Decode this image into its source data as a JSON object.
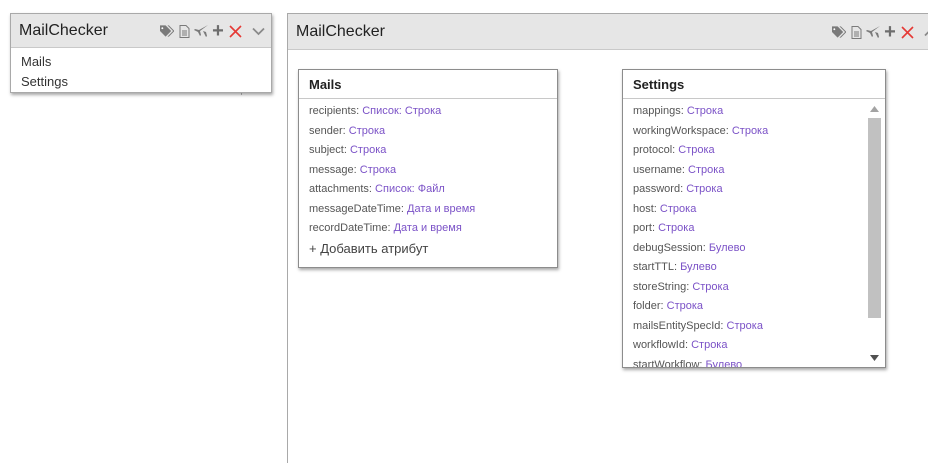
{
  "left_panel": {
    "title": "MailChecker",
    "items": [
      "Mails",
      "Settings"
    ]
  },
  "canvas": {
    "title": "MailChecker"
  },
  "icons": {
    "tags": "tags-icon",
    "document": "document-icon",
    "rocket": "rocket-icon",
    "add": "plus-icon",
    "close": "close-icon",
    "collapse": "chevron-down-icon",
    "expand": "chevron-up-icon"
  },
  "colors": {
    "type_text": "#7b52c7",
    "close_icon": "#e53935",
    "header_bg": "#e6e6e6"
  },
  "mails_entity": {
    "title": "Mails",
    "attributes": [
      {
        "name": "recipients:",
        "type": "Список: Строка"
      },
      {
        "name": "sender:",
        "type": "Строка"
      },
      {
        "name": "subject:",
        "type": "Строка"
      },
      {
        "name": "message:",
        "type": "Строка"
      },
      {
        "name": "attachments:",
        "type": "Список: Файл"
      },
      {
        "name": "messageDateTime:",
        "type": "Дата и время"
      },
      {
        "name": "recordDateTime:",
        "type": "Дата и время"
      }
    ],
    "add_label": "+ Добавить атрибут"
  },
  "settings_entity": {
    "title": "Settings",
    "attributes": [
      {
        "name": "mappings:",
        "type": "Строка"
      },
      {
        "name": "workingWorkspace:",
        "type": "Строка"
      },
      {
        "name": "protocol:",
        "type": "Строка"
      },
      {
        "name": "username:",
        "type": "Строка"
      },
      {
        "name": "password:",
        "type": "Строка"
      },
      {
        "name": "host:",
        "type": "Строка"
      },
      {
        "name": "port:",
        "type": "Строка"
      },
      {
        "name": "debugSession:",
        "type": "Булево"
      },
      {
        "name": "startTTL:",
        "type": "Булево"
      },
      {
        "name": "storeString:",
        "type": "Строка"
      },
      {
        "name": "folder:",
        "type": "Строка"
      },
      {
        "name": "mailsEntitySpecId:",
        "type": "Строка"
      },
      {
        "name": "workflowId:",
        "type": "Строка"
      },
      {
        "name": "startWorkflow:",
        "type": "Булево"
      }
    ]
  }
}
